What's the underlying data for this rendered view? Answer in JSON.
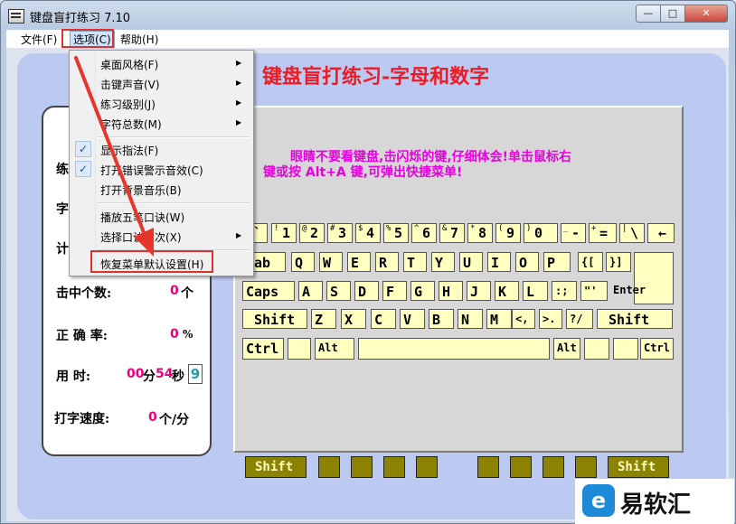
{
  "window": {
    "title": "键盘盲打练习 7.10",
    "min": "—",
    "max": "□",
    "close": "✕"
  },
  "menubar": {
    "file": "文件(F)",
    "options": "选项(C)",
    "help": "帮助(H)"
  },
  "heading": "键盘盲打练习-字母和数字",
  "hint": [
    "眼睛不要看键盘,击闪烁的键,仔细体会!单击鼠标右",
    "键或按 Alt+A 键,可弹出快捷菜单!"
  ],
  "stats": {
    "row1_label": "练",
    "row2_label": "字",
    "row3_label": "计",
    "hits_label": "击中个数:",
    "hits_value": "0",
    "hits_unit": "个",
    "accuracy_label": "正 确 率:",
    "accuracy_value": "0",
    "accuracy_unit": "%",
    "time_label": "用   时:",
    "time_min": "00",
    "time_min_unit": "分",
    "time_sec": "54",
    "time_sec_unit": "秒",
    "time_box": "9",
    "speed_label": "打字速度:",
    "speed_value": "0",
    "speed_unit": "个/分"
  },
  "dropdown": {
    "items": [
      {
        "label": "桌面风格(F)"
      },
      {
        "label": "击键声音(V)"
      },
      {
        "label": "练习级别(J)"
      },
      {
        "label": "字符总数(M)"
      },
      {
        "label": "显示指法(F)"
      },
      {
        "label": "打开错误警示音效(C)"
      },
      {
        "label": "打开背景音乐(B)"
      },
      {
        "label": "播放五笔口诀(W)"
      },
      {
        "label": "选择口诀版次(X)"
      },
      {
        "label": "恢复菜单默认设置(H)"
      }
    ],
    "check": "✓",
    "arrow": "▶"
  },
  "keyboard": {
    "row1": [
      {
        "s": "~",
        "l": "`"
      },
      {
        "s": "!",
        "l": "1"
      },
      {
        "s": "@",
        "l": "2"
      },
      {
        "s": "#",
        "l": "3"
      },
      {
        "s": "$",
        "l": "4"
      },
      {
        "s": "%",
        "l": "5"
      },
      {
        "s": "^",
        "l": "6"
      },
      {
        "s": "&",
        "l": "7"
      },
      {
        "s": "*",
        "l": "8"
      },
      {
        "s": "(",
        "l": "9"
      },
      {
        "s": ")",
        "l": "0"
      },
      {
        "s": "_",
        "l": "-"
      },
      {
        "s": "+",
        "l": "="
      },
      {
        "s": "|",
        "l": "\\"
      },
      {
        "s": "",
        "l": "←"
      }
    ],
    "row2": [
      "Tab",
      "Q",
      "W",
      "E",
      "R",
      "T",
      "Y",
      "U",
      "I",
      "O",
      "P",
      "{[",
      "}]"
    ],
    "enter": "Enter",
    "row3": [
      "Caps",
      "A",
      "S",
      "D",
      "F",
      "G",
      "H",
      "J",
      "K",
      "L",
      ":;",
      "\"'"
    ],
    "row4": [
      "Shift",
      "Z",
      "X",
      "C",
      "V",
      "B",
      "N",
      "M",
      "<,",
      ">.",
      "?/",
      "Shift"
    ],
    "row5": [
      "Ctrl",
      "",
      "Alt",
      "",
      "Alt",
      "",
      "",
      "Ctrl"
    ],
    "bottom_shift_left": "Shift",
    "bottom_shift_right": "Shift"
  },
  "watermark": {
    "icon": "e",
    "text": "易软汇"
  }
}
